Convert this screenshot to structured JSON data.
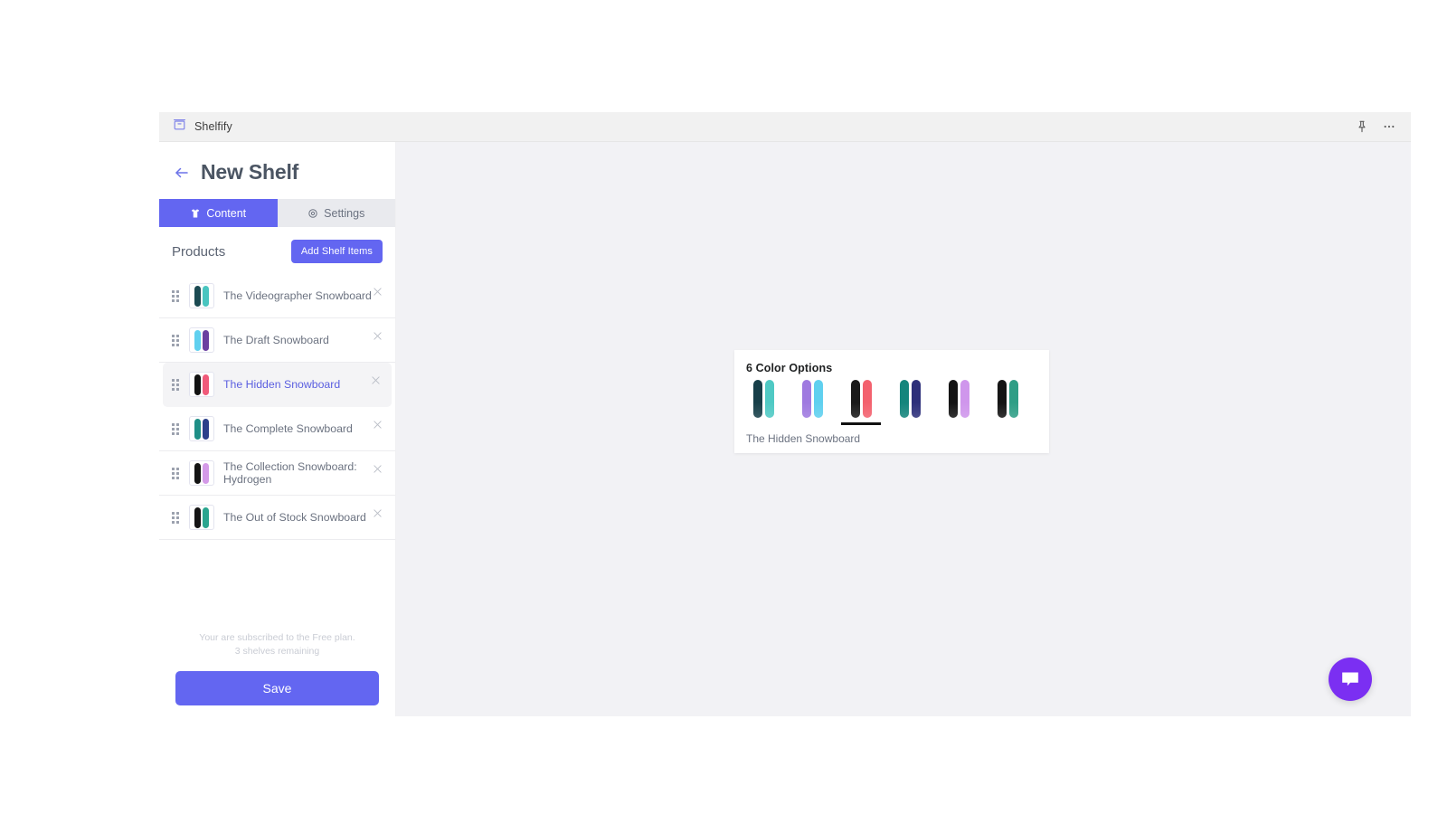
{
  "topbar": {
    "brand": "Shelfify",
    "brand_icon": "shelf-box-icon",
    "pin_icon": "pin-icon",
    "more_icon": "ellipsis-icon",
    "bg": "#f1f1f1"
  },
  "sidebar": {
    "back_icon": "arrow-left-icon",
    "title": "New Shelf",
    "tabs": [
      {
        "label": "Content",
        "icon": "tshirt-icon",
        "active": true
      },
      {
        "label": "Settings",
        "icon": "gear-icon",
        "active": false
      }
    ],
    "products_label": "Products",
    "add_button": "Add Shelf Items",
    "products": [
      {
        "name": "The Videographer Snowboard",
        "selected": false,
        "colors": [
          "#1b4a52",
          "#49c5c0"
        ]
      },
      {
        "name": "The Draft Snowboard",
        "selected": false,
        "colors": [
          "#5fd0ef",
          "#6b3fa0"
        ]
      },
      {
        "name": "The Hidden Snowboard",
        "selected": true,
        "colors": [
          "#121212",
          "#f05a7a"
        ]
      },
      {
        "name": "The Complete Snowboard",
        "selected": false,
        "colors": [
          "#1f8f86",
          "#2b3f8a"
        ]
      },
      {
        "name": "The Collection Snowboard: Hydrogen",
        "selected": false,
        "colors": [
          "#131313",
          "#d49ae8"
        ]
      },
      {
        "name": "The Out of Stock Snowboard",
        "selected": false,
        "colors": [
          "#141414",
          "#2aa58f"
        ]
      }
    ],
    "remove_icon": "close-x-icon",
    "drag_icon": "drag-handle-icon",
    "plan_line_1": "Your are subscribed to the Free plan.",
    "plan_line_2": "3 shelves remaining",
    "save_label": "Save",
    "accent": "#6366f1"
  },
  "preview_card": {
    "title": "6 Color Options",
    "caption": "The Hidden Snowboard",
    "active_index": 2,
    "swatches": [
      {
        "name": "videographer",
        "colors": [
          "#173f49",
          "#4fc9c4"
        ]
      },
      {
        "name": "draft",
        "colors": [
          "#9f7ae0",
          "#5fd0ef"
        ]
      },
      {
        "name": "hidden",
        "colors": [
          "#1a1a1a",
          "#f3616e"
        ]
      },
      {
        "name": "complete",
        "colors": [
          "#14857c",
          "#2d2f7a"
        ]
      },
      {
        "name": "hydrogen",
        "colors": [
          "#141414",
          "#cf96ec"
        ]
      },
      {
        "name": "outofstock",
        "colors": [
          "#141414",
          "#2f9e86"
        ]
      }
    ]
  },
  "chat": {
    "icon": "chat-bubble-icon",
    "color": "#7b2ff2"
  }
}
